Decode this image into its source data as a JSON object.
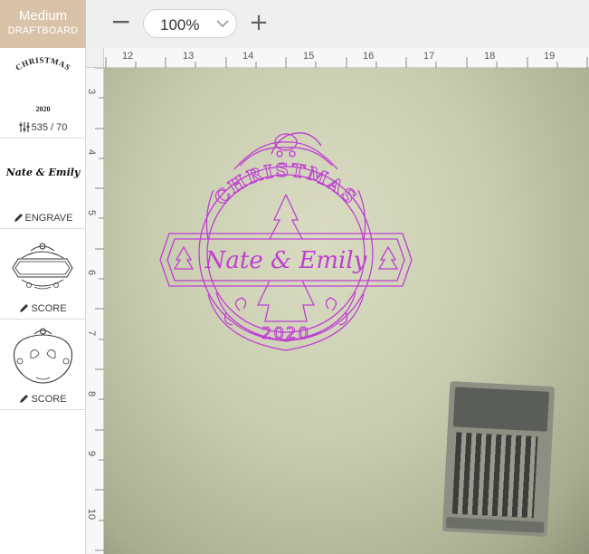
{
  "material": {
    "line1": "Medium",
    "line2": "DRAFTBOARD",
    "bg_color": "#d9c3a8"
  },
  "toolbar": {
    "zoom_out_label": "−",
    "zoom_value": "100%",
    "zoom_in_label": "+"
  },
  "steps": [
    {
      "name": "christmas-arc-text",
      "preview_top": "CHRISTMAS",
      "preview_bottom": "2020",
      "label": "535 / 70",
      "label_icon": "slider-icon"
    },
    {
      "name": "names-text",
      "preview": "Nate & Emily",
      "label": "ENGRAVE",
      "label_icon": "pencil-icon"
    },
    {
      "name": "banner-score",
      "label": "SCORE",
      "label_icon": "pencil-icon"
    },
    {
      "name": "ornament-score",
      "label": "SCORE",
      "label_icon": "pencil-icon"
    }
  ],
  "ruler": {
    "top": [
      "12",
      "13",
      "14",
      "15",
      "16",
      "17",
      "18",
      "19"
    ],
    "left": [
      "3",
      "4",
      "5",
      "6",
      "7",
      "8",
      "9",
      "10"
    ]
  },
  "design": {
    "top_text": "CHRISTMAS",
    "names": "Nate & Emily",
    "year": "2020",
    "color": "#c03ed3"
  },
  "canvas": {
    "bg_color": "#c9cdb0"
  }
}
